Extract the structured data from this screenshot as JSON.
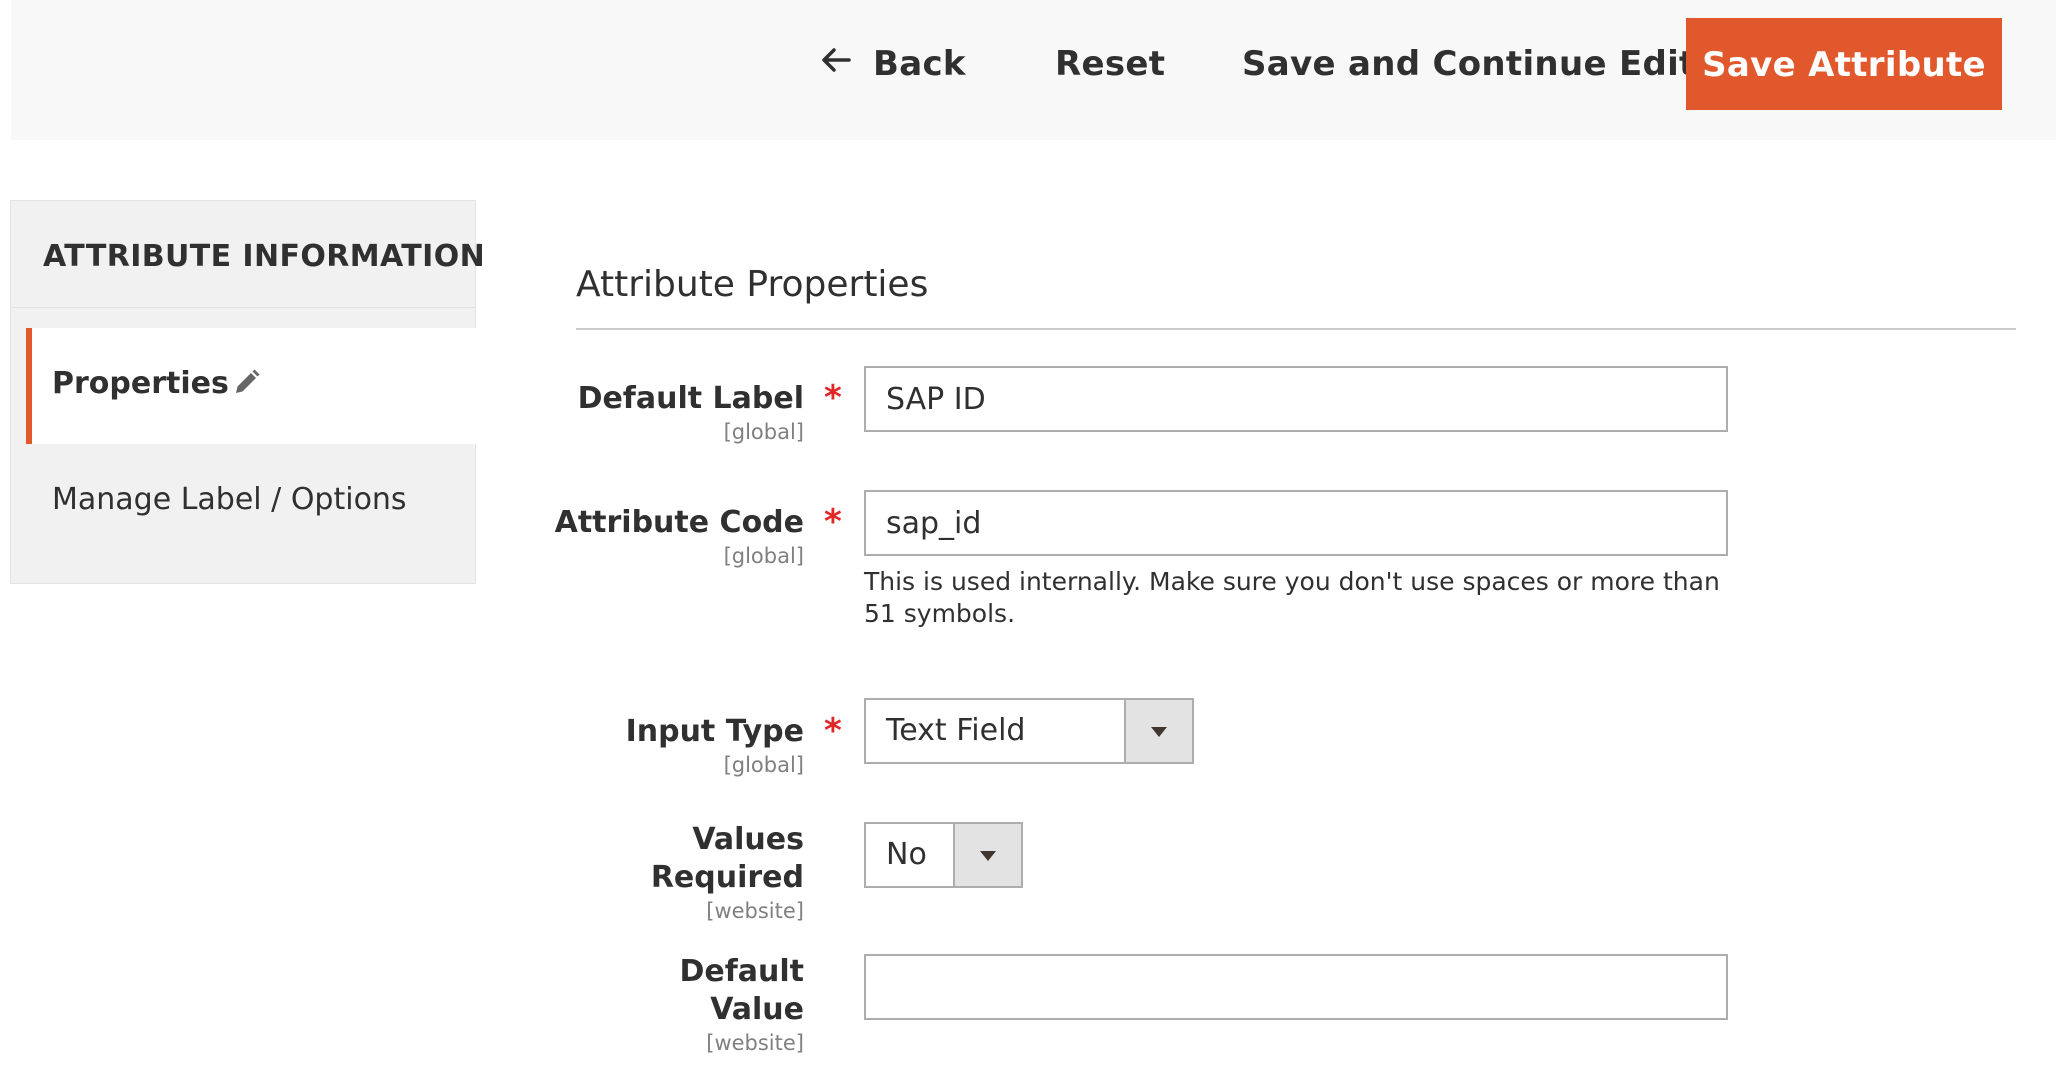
{
  "header": {
    "back_label": "Back",
    "reset_label": "Reset",
    "save_continue_label": "Save and Continue Edit",
    "save_label": "Save Attribute"
  },
  "sidebar": {
    "title": "ATTRIBUTE INFORMATION",
    "items": [
      {
        "label": "Properties",
        "active": true,
        "icon": "pencil-icon"
      },
      {
        "label": "Manage Label / Options",
        "active": false
      }
    ]
  },
  "main": {
    "section_title": "Attribute Properties",
    "fields": {
      "default_label": {
        "label": "Default Label",
        "scope": "[global]",
        "value": "SAP ID",
        "required": "*"
      },
      "attribute_code": {
        "label": "Attribute Code",
        "scope": "[global]",
        "value": "sap_id",
        "required": "*",
        "note": "This is used internally. Make sure you don't use spaces or more than 51 symbols."
      },
      "input_type": {
        "label": "Input Type",
        "scope": "[global]",
        "value": "Text Field",
        "required": "*"
      },
      "values_required": {
        "label_line1": "Values",
        "label_line2": "Required",
        "scope": "[website]",
        "value": "No"
      },
      "default_value": {
        "label_line1": "Default",
        "label_line2": "Value",
        "scope": "[website]",
        "value": ""
      }
    }
  },
  "colors": {
    "accent": "#e0582b",
    "required": "#e22626",
    "border": "#adadad",
    "header_bg": "#f8f8f8",
    "sidebar_bg": "#f1f1f1"
  }
}
